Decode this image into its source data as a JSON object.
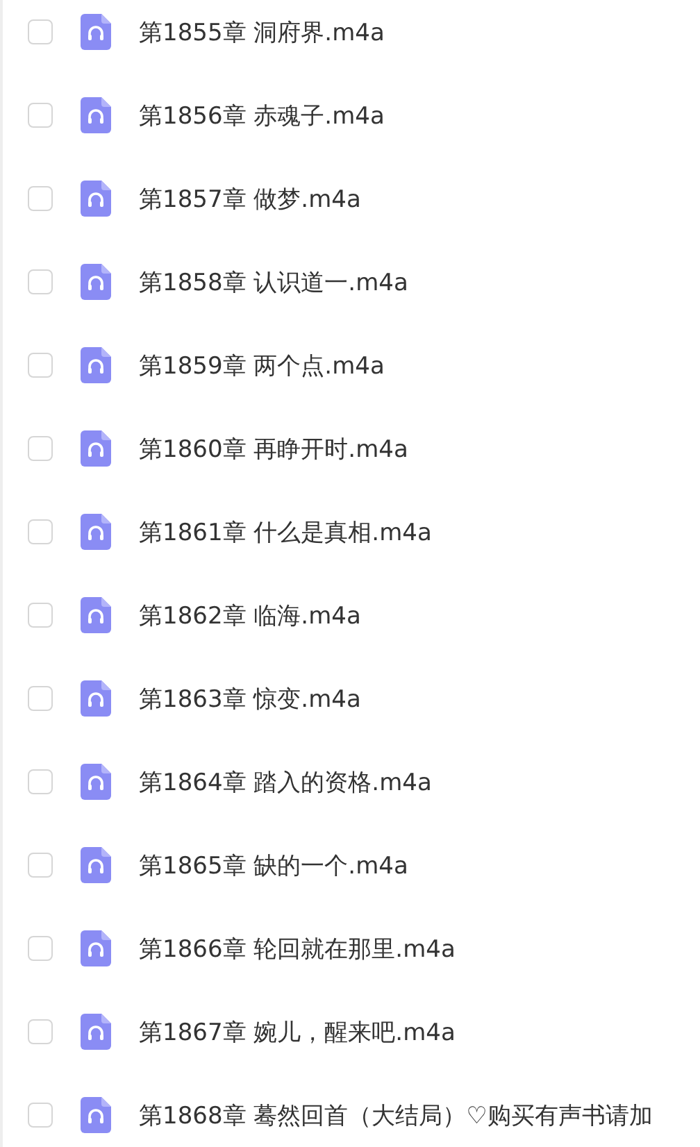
{
  "files": [
    {
      "name": "第1855章 洞府界.m4a",
      "checked": false
    },
    {
      "name": "第1856章 赤魂子.m4a",
      "checked": false
    },
    {
      "name": "第1857章 做梦.m4a",
      "checked": false
    },
    {
      "name": "第1858章 认识道一.m4a",
      "checked": false
    },
    {
      "name": "第1859章 两个点.m4a",
      "checked": false
    },
    {
      "name": "第1860章 再睁开时.m4a",
      "checked": false
    },
    {
      "name": "第1861章 什么是真相.m4a",
      "checked": false
    },
    {
      "name": "第1862章 临海.m4a",
      "checked": false
    },
    {
      "name": "第1863章 惊变.m4a",
      "checked": false
    },
    {
      "name": "第1864章 踏入的资格.m4a",
      "checked": false
    },
    {
      "name": "第1865章 缺的一个.m4a",
      "checked": false
    },
    {
      "name": "第1866章 轮回就在那里.m4a",
      "checked": false
    },
    {
      "name": "第1867章 婉儿，醒来吧.m4a",
      "checked": false
    },
    {
      "name": "第1868章 蓦然回首（大结局）♡购买有声书请加",
      "checked": false
    }
  ]
}
